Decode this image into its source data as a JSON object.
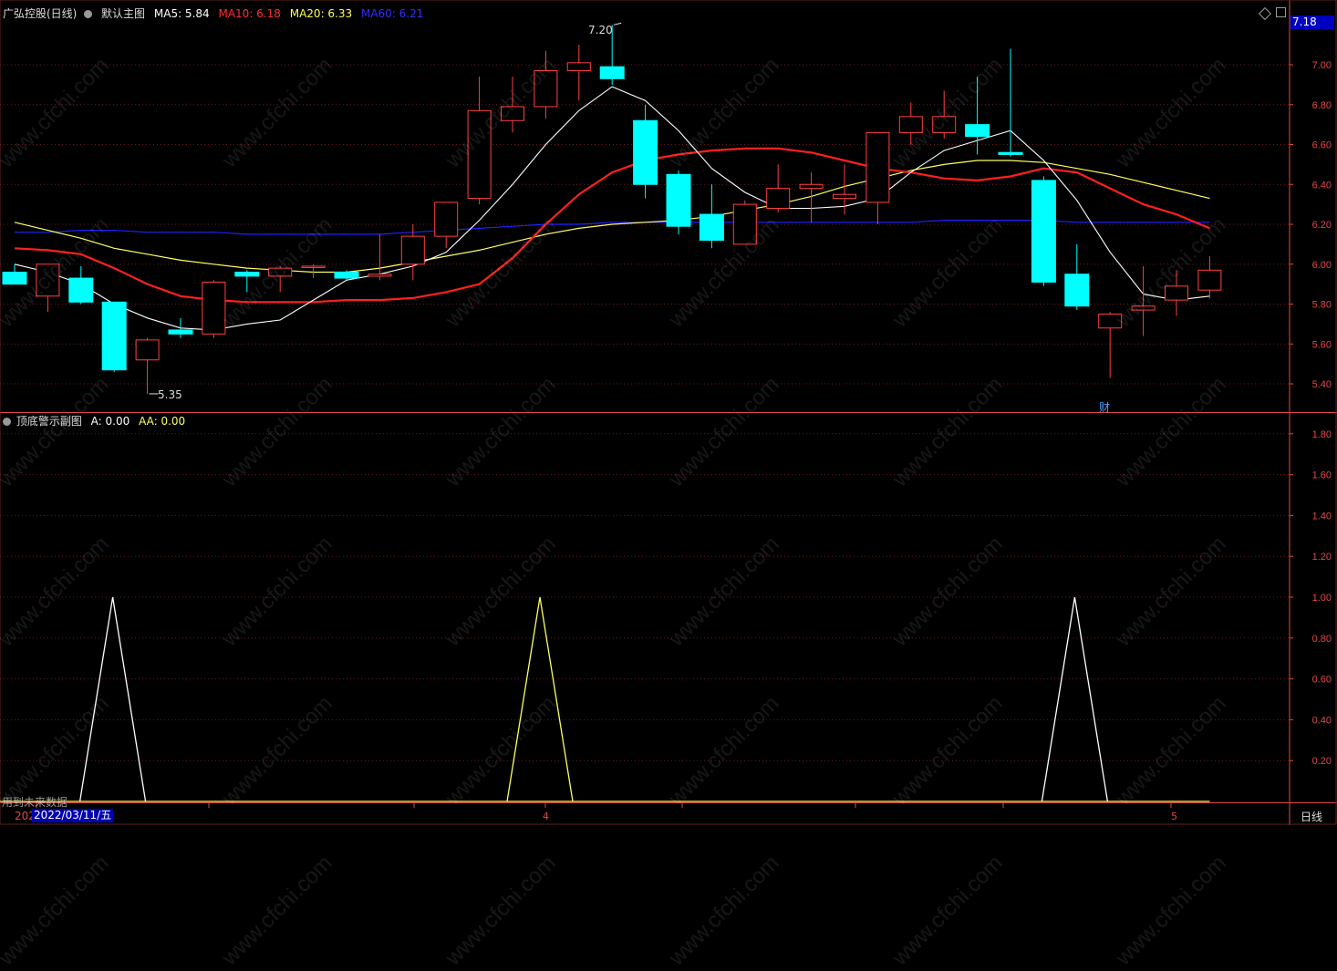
{
  "main_header": {
    "stock": "广弘控股(日线)",
    "template": "默认主图",
    "ma5": "MA5: 5.84",
    "ma10": "MA10: 6.18",
    "ma20": "MA20: 6.33",
    "ma60": "MA60: 6.21"
  },
  "sub_header": {
    "title": "顶底警示副图",
    "a": "A: 0.00",
    "aa": "AA: 0.00"
  },
  "current_price_label": "7.18",
  "period_label": "日线",
  "future_data_notice": "用到未来数据",
  "cursor_date": "2022/03/11/五",
  "date_prefix": "202",
  "month_labels": [
    "4",
    "5"
  ],
  "high_label": "7.20",
  "low_label": "5.35",
  "finance_marker": "财",
  "watermark": "www.cfchi.com",
  "colors": {
    "up": "#ff4040",
    "down": "#00ffff",
    "ma5": "#ffffff",
    "ma10": "#ff2020",
    "ma20": "#ffff60",
    "ma60": "#2020ff",
    "axis": "#e04848"
  },
  "chart_data": [
    {
      "type": "candlestick",
      "title": "广弘控股(日线)",
      "ylim": [
        5.3,
        7.25
      ],
      "y_ticks": [
        5.4,
        5.6,
        5.8,
        6.0,
        6.2,
        6.4,
        6.6,
        6.8,
        7.0
      ],
      "candles": [
        {
          "o": 5.96,
          "h": 6.0,
          "l": 5.9,
          "c": 5.9
        },
        {
          "o": 5.84,
          "h": 6.0,
          "l": 5.76,
          "c": 6.0
        },
        {
          "o": 5.93,
          "h": 5.99,
          "l": 5.8,
          "c": 5.81
        },
        {
          "o": 5.81,
          "h": 5.81,
          "l": 5.46,
          "c": 5.47
        },
        {
          "o": 5.52,
          "h": 5.63,
          "l": 5.35,
          "c": 5.62
        },
        {
          "o": 5.67,
          "h": 5.73,
          "l": 5.63,
          "c": 5.65
        },
        {
          "o": 5.65,
          "h": 5.92,
          "l": 5.63,
          "c": 5.91
        },
        {
          "o": 5.96,
          "h": 5.97,
          "l": 5.86,
          "c": 5.94
        },
        {
          "o": 5.94,
          "h": 5.99,
          "l": 5.86,
          "c": 5.98
        },
        {
          "o": 5.99,
          "h": 6.0,
          "l": 5.93,
          "c": 5.99
        },
        {
          "o": 5.96,
          "h": 5.97,
          "l": 5.92,
          "c": 5.93
        },
        {
          "o": 5.94,
          "h": 6.15,
          "l": 5.92,
          "c": 5.95
        },
        {
          "o": 6.0,
          "h": 6.2,
          "l": 5.92,
          "c": 6.14
        },
        {
          "o": 6.14,
          "h": 6.3,
          "l": 6.08,
          "c": 6.31
        },
        {
          "o": 6.33,
          "h": 6.94,
          "l": 6.3,
          "c": 6.77
        },
        {
          "o": 6.72,
          "h": 6.94,
          "l": 6.66,
          "c": 6.79
        },
        {
          "o": 6.79,
          "h": 7.07,
          "l": 6.73,
          "c": 6.97
        },
        {
          "o": 6.97,
          "h": 7.1,
          "l": 6.82,
          "c": 7.01
        },
        {
          "o": 6.99,
          "h": 7.2,
          "l": 6.9,
          "c": 6.93
        },
        {
          "o": 6.72,
          "h": 6.8,
          "l": 6.33,
          "c": 6.4
        },
        {
          "o": 6.45,
          "h": 6.47,
          "l": 6.15,
          "c": 6.19
        },
        {
          "o": 6.25,
          "h": 6.4,
          "l": 6.08,
          "c": 6.12
        },
        {
          "o": 6.1,
          "h": 6.32,
          "l": 6.1,
          "c": 6.3
        },
        {
          "o": 6.28,
          "h": 6.5,
          "l": 6.26,
          "c": 6.38
        },
        {
          "o": 6.38,
          "h": 6.46,
          "l": 6.21,
          "c": 6.4
        },
        {
          "o": 6.33,
          "h": 6.5,
          "l": 6.25,
          "c": 6.35
        },
        {
          "o": 6.31,
          "h": 6.66,
          "l": 6.2,
          "c": 6.66
        },
        {
          "o": 6.66,
          "h": 6.81,
          "l": 6.6,
          "c": 6.74
        },
        {
          "o": 6.66,
          "h": 6.87,
          "l": 6.63,
          "c": 6.74
        },
        {
          "o": 6.7,
          "h": 6.94,
          "l": 6.55,
          "c": 6.64
        },
        {
          "o": 6.56,
          "h": 7.08,
          "l": 6.54,
          "c": 6.55
        },
        {
          "o": 6.42,
          "h": 6.44,
          "l": 5.89,
          "c": 5.91
        },
        {
          "o": 5.95,
          "h": 6.1,
          "l": 5.77,
          "c": 5.79
        },
        {
          "o": 5.68,
          "h": 5.76,
          "l": 5.43,
          "c": 5.75
        },
        {
          "o": 5.77,
          "h": 5.99,
          "l": 5.64,
          "c": 5.79
        },
        {
          "o": 5.82,
          "h": 5.97,
          "l": 5.74,
          "c": 5.89
        },
        {
          "o": 5.87,
          "h": 6.04,
          "l": 5.83,
          "c": 5.97
        }
      ],
      "ma5": [
        6.0,
        5.96,
        5.9,
        5.8,
        5.73,
        5.68,
        5.67,
        5.7,
        5.72,
        5.82,
        5.92,
        5.95,
        5.99,
        6.06,
        6.22,
        6.4,
        6.6,
        6.77,
        6.89,
        6.82,
        6.67,
        6.48,
        6.36,
        6.28,
        6.28,
        6.29,
        6.33,
        6.46,
        6.57,
        6.62,
        6.67,
        6.52,
        6.32,
        6.06,
        5.85,
        5.82,
        5.84
      ],
      "ma10": [
        6.08,
        6.07,
        6.05,
        5.98,
        5.9,
        5.84,
        5.82,
        5.81,
        5.81,
        5.81,
        5.82,
        5.82,
        5.83,
        5.86,
        5.9,
        6.03,
        6.2,
        6.35,
        6.46,
        6.52,
        6.55,
        6.57,
        6.58,
        6.58,
        6.56,
        6.52,
        6.48,
        6.46,
        6.43,
        6.42,
        6.44,
        6.48,
        6.46,
        6.38,
        6.3,
        6.25,
        6.18
      ],
      "ma20": [
        6.21,
        6.17,
        6.13,
        6.08,
        6.05,
        6.02,
        6.0,
        5.98,
        5.97,
        5.96,
        5.96,
        5.98,
        6.01,
        6.04,
        6.07,
        6.11,
        6.15,
        6.18,
        6.2,
        6.21,
        6.22,
        6.24,
        6.27,
        6.3,
        6.34,
        6.39,
        6.43,
        6.47,
        6.5,
        6.52,
        6.52,
        6.51,
        6.48,
        6.45,
        6.41,
        6.37,
        6.33
      ],
      "ma60": [
        6.16,
        6.16,
        6.17,
        6.17,
        6.16,
        6.16,
        6.16,
        6.15,
        6.15,
        6.15,
        6.15,
        6.15,
        6.16,
        6.17,
        6.18,
        6.19,
        6.2,
        6.2,
        6.21,
        6.21,
        6.21,
        6.21,
        6.21,
        6.21,
        6.21,
        6.21,
        6.21,
        6.21,
        6.22,
        6.22,
        6.22,
        6.22,
        6.21,
        6.21,
        6.21,
        6.21,
        6.21
      ]
    },
    {
      "type": "line",
      "title": "顶底警示副图",
      "ylim": [
        0,
        1.9
      ],
      "y_ticks": [
        0.2,
        0.4,
        0.6,
        0.8,
        1.0,
        1.2,
        1.4,
        1.6,
        1.8
      ],
      "series": [
        {
          "name": "A",
          "peaks": [
            {
              "bar": 3,
              "value": 1.0
            },
            {
              "bar": 16,
              "value": 1.0
            },
            {
              "bar": 32,
              "value": 1.0
            }
          ]
        },
        {
          "name": "AA",
          "peaks": []
        }
      ]
    }
  ]
}
